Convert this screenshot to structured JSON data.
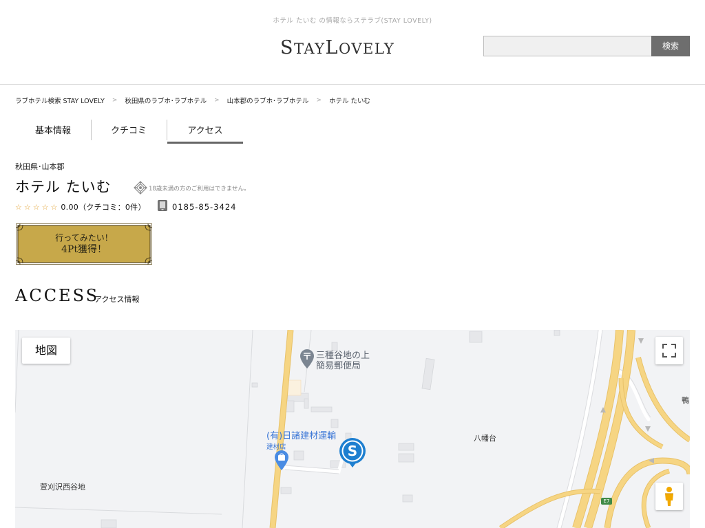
{
  "header": {
    "tagline": "ホテル たいむ の情報ならステラブ(STAY LOVELY)",
    "logo": {
      "part1_big": "S",
      "part1_small": "TAY",
      "part2_big": "L",
      "part2_small": "OVELY"
    },
    "search": {
      "placeholder": "",
      "value": "",
      "button_label": "検索"
    }
  },
  "breadcrumb": [
    {
      "label": "ラブホテル検索 STAY LOVELY"
    },
    {
      "label": "秋田県のラブホ･ラブホテル"
    },
    {
      "label": "山本郡のラブホ･ラブホテル"
    },
    {
      "label": "ホテル たいむ"
    }
  ],
  "breadcrumb_separator": ">",
  "tabs": [
    {
      "label": "基本情報",
      "active": false
    },
    {
      "label": "クチコミ",
      "active": false
    },
    {
      "label": "アクセス",
      "active": true
    }
  ],
  "hotel": {
    "area": "秋田県･山本郡",
    "name": "ホテル たいむ",
    "age_notice": "18歳未満の方のご利用はできません。",
    "rating": {
      "value": 0.0,
      "max": 5,
      "text": "0.00（クチコミ：0件）"
    },
    "phone": "0185-85-3424"
  },
  "want_button": {
    "line1": "行ってみたい！",
    "line2": "4Pt獲得！"
  },
  "access": {
    "title": "ACCESS",
    "subtitle": "アクセス情報"
  },
  "map": {
    "map_type_label": "地図",
    "labels": {
      "post_office_line1": "三種谷地の上",
      "post_office_line2": "簡易郵便局",
      "business_name": "(有)日諸建材運輸",
      "business_category": "建材店",
      "place_hachimandai": "八幡台",
      "place_kayakarisawa": "萱刈沢西谷地",
      "place_edge": "鴨",
      "highway_shield": "E7"
    },
    "colors": {
      "background": "#f2f3f5",
      "major_road": "#f6d583",
      "road_outline": "#e8c26a",
      "minor_road": "#ffffff",
      "building": "#e9eaec",
      "marker": "#1e7fd0"
    }
  },
  "colors": {
    "accent_gold": "#c7a84a",
    "tab_active_border": "#666666",
    "star": "#e3a53a"
  }
}
